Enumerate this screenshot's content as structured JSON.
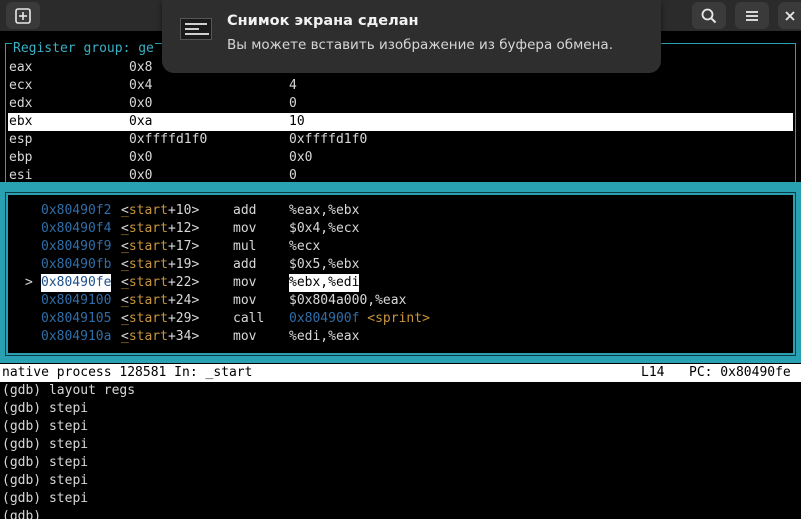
{
  "notification": {
    "title": "Снимок экрана сделан",
    "body": "Вы можете вставить изображение из буфера обмена."
  },
  "titlebar": {
    "new_tab_icon": "plus-square-icon",
    "search_icon": "search-icon",
    "menu_icon": "hamburger-menu-icon",
    "close_icon": "close-icon"
  },
  "registers": {
    "title": "Register group: ge",
    "rows": [
      {
        "name": "eax",
        "hex": "0x8",
        "dec": ""
      },
      {
        "name": "ecx",
        "hex": "0x4",
        "dec": "4"
      },
      {
        "name": "edx",
        "hex": "0x0",
        "dec": "0"
      },
      {
        "name": "ebx",
        "hex": "0xa",
        "dec": "10"
      },
      {
        "name": "esp",
        "hex": "0xffffd1f0",
        "dec": "0xffffd1f0"
      },
      {
        "name": "ebp",
        "hex": "0x0",
        "dec": "0x0"
      },
      {
        "name": "esi",
        "hex": "0x0",
        "dec": "0"
      }
    ]
  },
  "disassembly": {
    "rows": [
      {
        "marker": "",
        "addr": "0x80490f2",
        "sym_open": "<",
        "fn": "_start",
        "offset": "+10>",
        "op": "add",
        "args": "%eax,%ebx"
      },
      {
        "marker": "",
        "addr": "0x80490f4",
        "sym_open": "<",
        "fn": "_start",
        "offset": "+12>",
        "op": "mov",
        "args": "$0x4,%ecx"
      },
      {
        "marker": "",
        "addr": "0x80490f9",
        "sym_open": "<",
        "fn": "_start",
        "offset": "+17>",
        "op": "mul",
        "args": "%ecx"
      },
      {
        "marker": "",
        "addr": "0x80490fb",
        "sym_open": "<",
        "fn": "_start",
        "offset": "+19>",
        "op": "add",
        "args": "$0x5,%ebx"
      },
      {
        "marker": ">",
        "addr": "0x80490fe",
        "sym_open": "<",
        "fn": "_start",
        "offset": "+22>",
        "op": "mov",
        "args": "%ebx,%edi"
      },
      {
        "marker": "",
        "addr": "0x8049100",
        "sym_open": "<",
        "fn": "_start",
        "offset": "+24>",
        "op": "mov",
        "args": "$0x804a000,%eax"
      },
      {
        "marker": "",
        "addr": "0x8049105",
        "sym_open": "<",
        "fn": "_start",
        "offset": "+29>",
        "op": "call",
        "args": "",
        "call_addr": "0x804900f",
        "call_sym": "<sprint>"
      },
      {
        "marker": "",
        "addr": "0x804910a",
        "sym_open": "<",
        "fn": "_start",
        "offset": "+34>",
        "op": "mov",
        "args": "%edi,%eax"
      }
    ]
  },
  "status": {
    "process": "native process 128581 In: _start",
    "line": "L14",
    "pc": "PC: 0x80490fe"
  },
  "console": {
    "lines": [
      "(gdb) layout regs",
      "(gdb) stepi",
      "(gdb) stepi",
      "(gdb) stepi",
      "(gdb) stepi",
      "(gdb) stepi",
      "(gdb) stepi",
      "(gdb)"
    ]
  },
  "colors": {
    "border": "#2aa1b3",
    "address": "#2f6ea8",
    "function": "#c8953a"
  }
}
